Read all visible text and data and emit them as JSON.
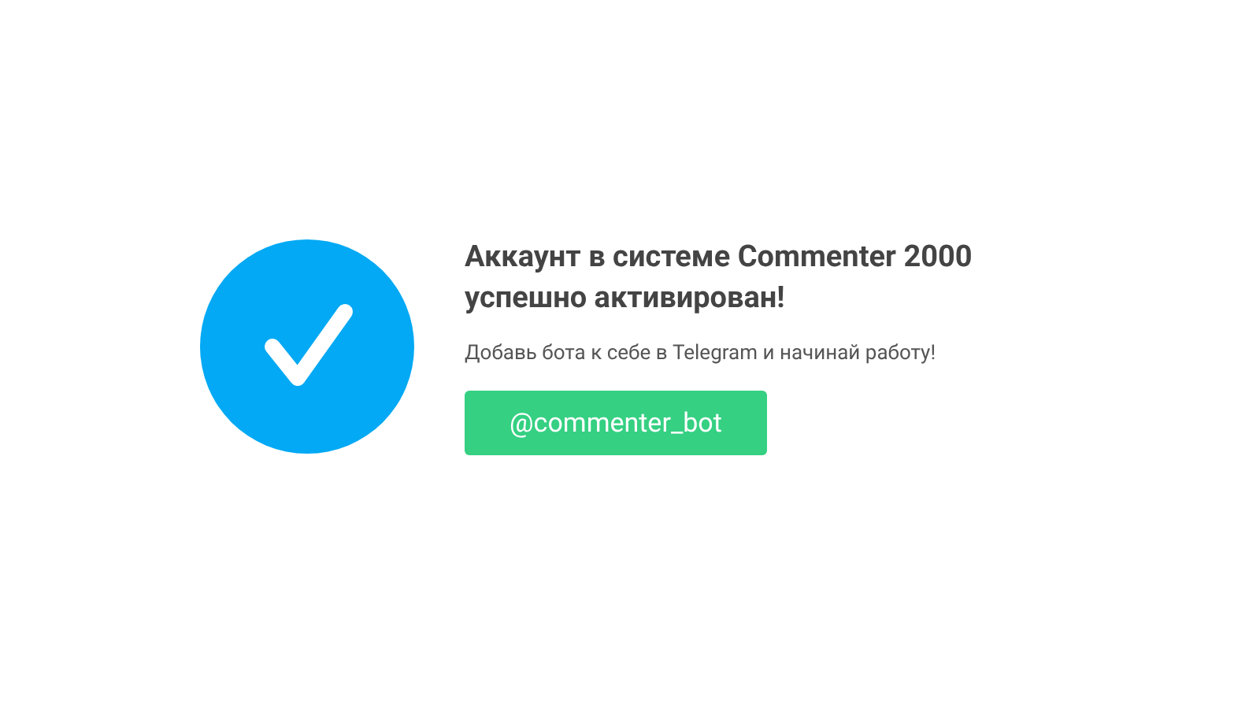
{
  "title": "Аккаунт в системе Commenter 2000 успешно активирован!",
  "subtitle": "Добавь бота к себе в Telegram и начинай работу!",
  "button": {
    "label": "@commenter_bot"
  }
}
